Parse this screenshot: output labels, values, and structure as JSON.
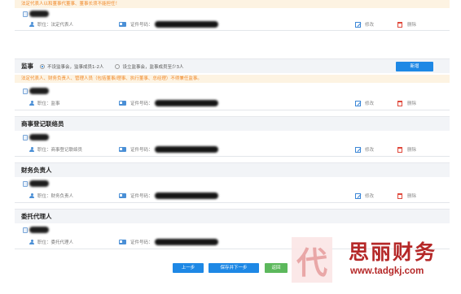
{
  "notice_top": "法定代表人以和董事代董事、董事长须不能担任！",
  "notice_supervisor": "法定代表人、财务负责人、管理人员（包括董事/理事、执行董事、总经理）不得兼任监事。",
  "labels": {
    "position_prefix": "职位：",
    "id_prefix": "证件号码：",
    "edit": "修改",
    "delete": "删除"
  },
  "legal_rep": {
    "position": "法定代表人"
  },
  "supervisor": {
    "title": "监事",
    "option_1": "不设监事会，监事成员1-2人",
    "option_2": "设立监事会，监事成员至少3人",
    "selected_option": "option_1",
    "add_button": "新增",
    "position": "监事"
  },
  "liaison": {
    "title": "商事登记联络员",
    "position": "商事登记联络员"
  },
  "finance": {
    "title": "财务负责人",
    "position": "财务负责人"
  },
  "agent": {
    "title": "委托代理人",
    "position": "委托代理人"
  },
  "buttons": {
    "prev": "上一步",
    "save_next": "保存并下一步",
    "back": "返回"
  },
  "watermark": {
    "seal": "代",
    "name": "思丽财务",
    "url": "www.tadgkj.com"
  },
  "colors": {
    "primary": "#1e88e5",
    "back_button": "#5cb85c",
    "notice_text": "#f0892a",
    "watermark": "#b52828"
  }
}
